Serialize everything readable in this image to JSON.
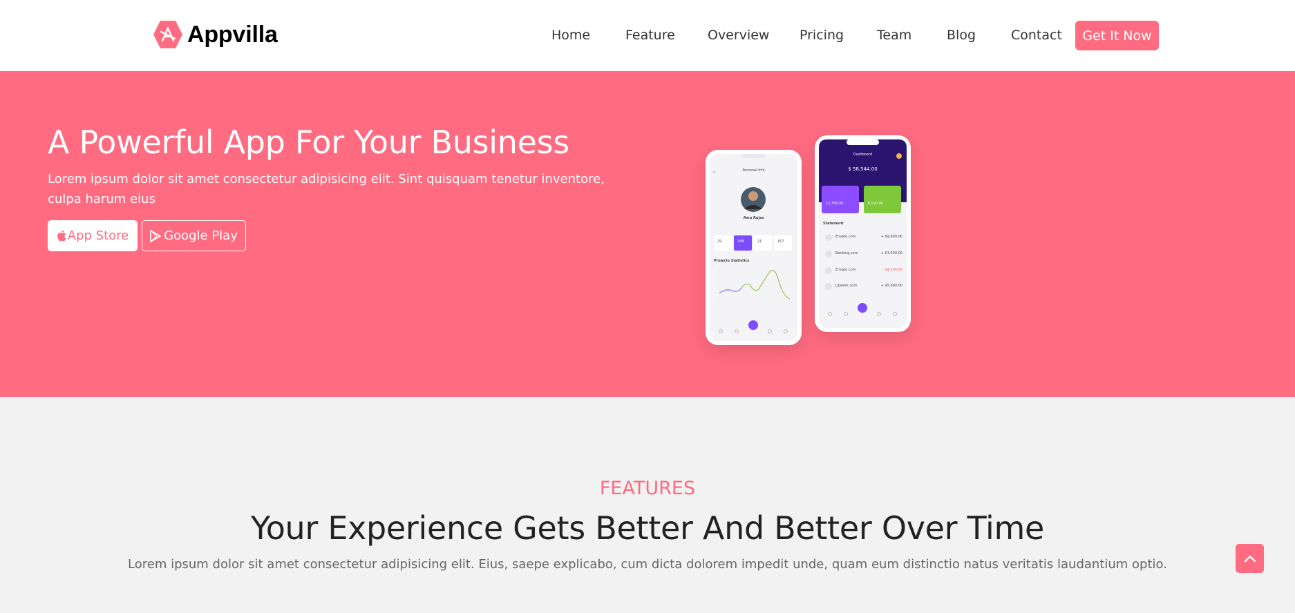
{
  "brand": {
    "name": "Appvilla",
    "accent": "#ff6b81"
  },
  "nav": {
    "items": [
      "Home",
      "Feature",
      "Overview",
      "Pricing",
      "Team",
      "Blog",
      "Contact"
    ],
    "cta_label": "Get It Now"
  },
  "hero": {
    "title": "A Powerful App For Your Business",
    "text": "Lorem ipsum dolor sit amet consectetur adipisicing elit. Sint quisquam tenetur inventore, culpa harum eius",
    "app_store_label": "App Store",
    "app_store_icon": "apple-icon",
    "google_play_label": "Google Play",
    "google_play_icon": "play-icon"
  },
  "phone_profile": {
    "header": "Personal Info",
    "name": "Amu Rujes",
    "stats": [
      "29",
      "348",
      "21",
      "167"
    ],
    "chart_title": "Projects Statistics"
  },
  "phone_dashboard": {
    "header": "Dashboard",
    "balance": "$ 58,544.00",
    "card1": "12,350.00",
    "card2": "6,520.00",
    "statement_title": "Statement",
    "rows": [
      {
        "name": "Envato.com",
        "amount": "+ $9,800.00"
      },
      {
        "name": "Banking.com",
        "amount": "+ €3,400.00"
      },
      {
        "name": "Envato.com",
        "amount": "- $4,200.00"
      },
      {
        "name": "Upwork.com",
        "amount": "+ $5,800.00"
      }
    ]
  },
  "features": {
    "label": "FEATURES",
    "title": "Your Experience Gets Better And Better Over Time",
    "text": "Lorem ipsum dolor sit amet consectetur adipisicing elit. Eius, saepe explicabo, cum dicta dolorem impedit unde, quam eum distinctio natus veritatis laudantium optio."
  },
  "scroll_top_icon": "chevron-up-icon"
}
